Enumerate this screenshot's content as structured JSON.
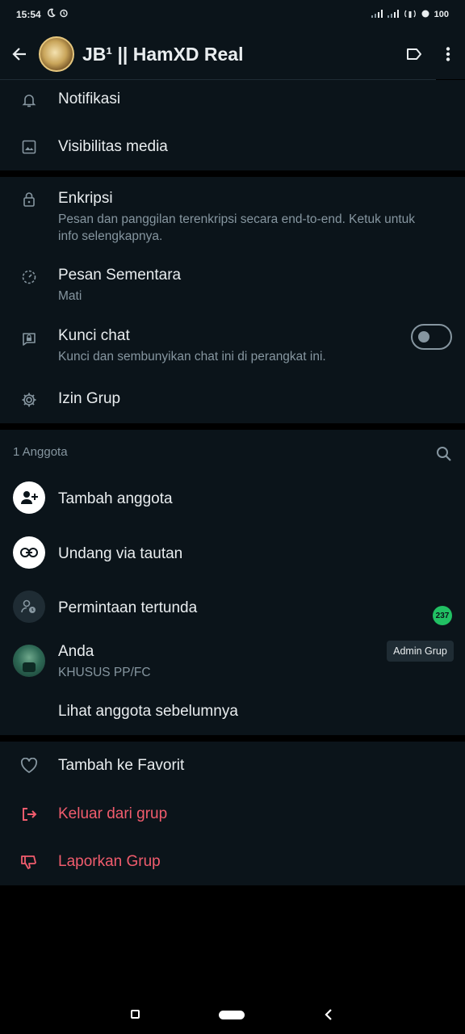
{
  "status_bar": {
    "time": "15:54",
    "battery": "100",
    "icons": [
      "do-not-disturb-icon",
      "alarm-icon",
      "signal-icon",
      "signal-icon",
      "hotspot-icon",
      "battery-icon"
    ]
  },
  "header": {
    "title": "JB¹ || HamXD Real",
    "icons": [
      "back-arrow-icon",
      "label-icon",
      "more-vert-icon"
    ]
  },
  "settings": {
    "notifications": "Notifikasi",
    "media_visibility": "Visibilitas media",
    "encryption": {
      "title": "Enkripsi",
      "subtitle": "Pesan dan panggilan terenkripsi secara end-to-end. Ketuk untuk info selengkapnya."
    },
    "disappearing": {
      "title": "Pesan Sementara",
      "subtitle": "Mati"
    },
    "chat_lock": {
      "title": "Kunci chat",
      "subtitle": "Kunci dan sembunyikan chat ini di perangkat ini.",
      "enabled": false
    },
    "group_permissions": "Izin Grup"
  },
  "members": {
    "header": "1 Anggota",
    "add_member": "Tambah anggota",
    "invite_link": "Undang via tautan",
    "pending_requests": {
      "label": "Permintaan tertunda",
      "count": "237"
    },
    "you": {
      "name": "Anda",
      "status": "KHUSUS PP/FC",
      "role": "Admin Grup"
    },
    "view_past": "Lihat anggota sebelumnya"
  },
  "actions": {
    "add_favorite": "Tambah ke Favorit",
    "exit_group": "Keluar dari grup",
    "report_group": "Laporkan Grup"
  },
  "colors": {
    "background": "#0b141a",
    "primary_text": "#e9edef",
    "secondary_text": "#8696a0",
    "danger": "#f15c6d",
    "accent_green": "#21c063"
  }
}
